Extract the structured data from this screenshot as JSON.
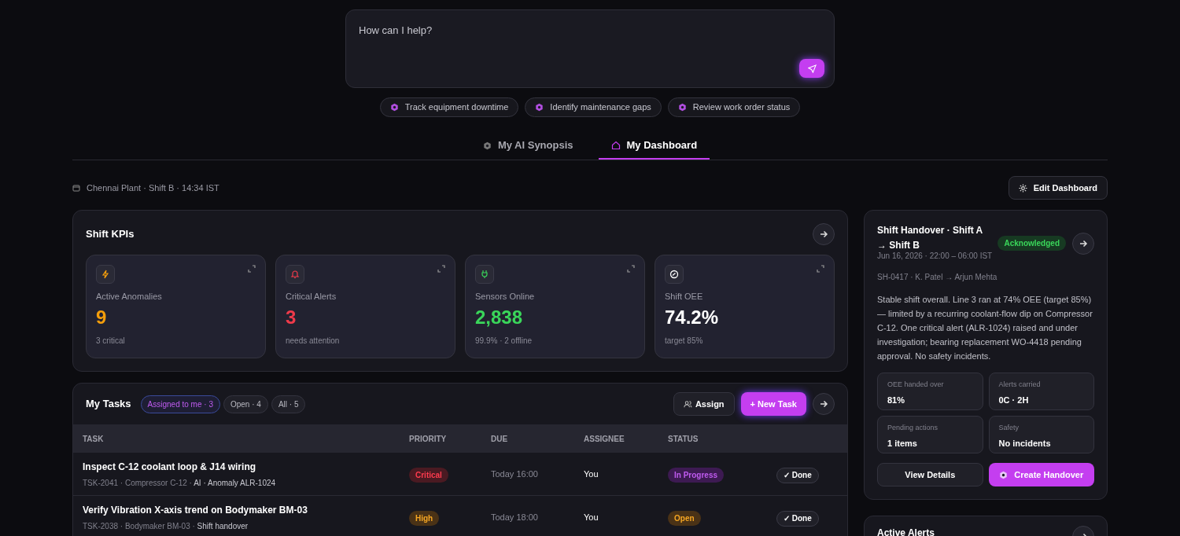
{
  "prompt": {
    "placeholder": "How can I help?"
  },
  "suggestions": [
    "Track equipment downtime",
    "Identify maintenance gaps",
    "Review work order status"
  ],
  "tabs": [
    {
      "label": "My AI Synopsis",
      "selected": false
    },
    {
      "label": "My Dashboard",
      "selected": true
    }
  ],
  "context": "Chennai Plant · Shift B · 14:34 IST",
  "edit_button": "Edit Dashboard",
  "kpis": {
    "title": "Shift KPIs",
    "cards": [
      {
        "label": "Active Anomalies",
        "value": "9",
        "note": "3 critical",
        "color": "#f59e0b"
      },
      {
        "label": "Critical Alerts",
        "value": "3",
        "note": "needs attention",
        "color": "#ef3a4a"
      },
      {
        "label": "Sensors Online",
        "value": "2,838",
        "note": "99.9% · 2 offline",
        "color": "#3ad65a"
      },
      {
        "label": "Shift OEE",
        "value": "74.2%",
        "note": "target 85%",
        "color": "#ffffff"
      }
    ]
  },
  "tasks": {
    "title": "My Tasks",
    "filters": [
      {
        "label": "Assigned to me · 3",
        "selected": true
      },
      {
        "label": "Open · 4",
        "selected": false
      },
      {
        "label": "All · 5",
        "selected": false
      }
    ],
    "assign_button": "Assign",
    "new_button": "+ New Task",
    "columns": [
      "TASK",
      "PRIORITY",
      "DUE",
      "ASSIGNEE",
      "STATUS"
    ],
    "rows": [
      {
        "title": "Inspect C-12 coolant loop & J14 wiring",
        "meta": "TSK-2041 · Compressor C-12 · ",
        "source": "AI · Anomaly ALR-1024",
        "priority": {
          "label": "Critical",
          "kind": "critical"
        },
        "due": "Today 16:00",
        "assignee": "You",
        "status": {
          "label": "In Progress",
          "kind": "progress"
        },
        "action": "✓ Done"
      },
      {
        "title": "Verify Vibration X-axis trend on Bodymaker BM-03",
        "meta": "TSK-2038 · Bodymaker BM-03 · ",
        "source": "Shift handover",
        "priority": {
          "label": "High",
          "kind": "high"
        },
        "due": "Today 18:00",
        "assignee": "You",
        "status": {
          "label": "Open",
          "kind": "open"
        },
        "action": "✓ Done"
      }
    ]
  },
  "handover": {
    "title": "Shift Handover · Shift A → Shift B",
    "badge": "Acknowledged",
    "time": "Jun 16, 2026 · 22:00 – 06:00 IST",
    "ref": "SH-0417 · K. Patel → Arjun Mehta",
    "summary": "Stable shift overall. Line 3 ran at 74% OEE (target 85%) — limited by a recurring coolant-flow dip on Compressor C-12. One critical alert (ALR-1024) raised and under investigation; bearing replacement WO-4418 pending approval. No safety incidents.",
    "stats": [
      {
        "label": "OEE handed over",
        "value": "81%"
      },
      {
        "label": "Alerts carried",
        "value": "0C · 2H"
      },
      {
        "label": "Pending actions",
        "value": "1 items"
      },
      {
        "label": "Safety",
        "value": "No incidents"
      }
    ],
    "view_button": "View Details",
    "create_button": "Create Handover"
  },
  "alerts": {
    "title": "Active Alerts"
  }
}
